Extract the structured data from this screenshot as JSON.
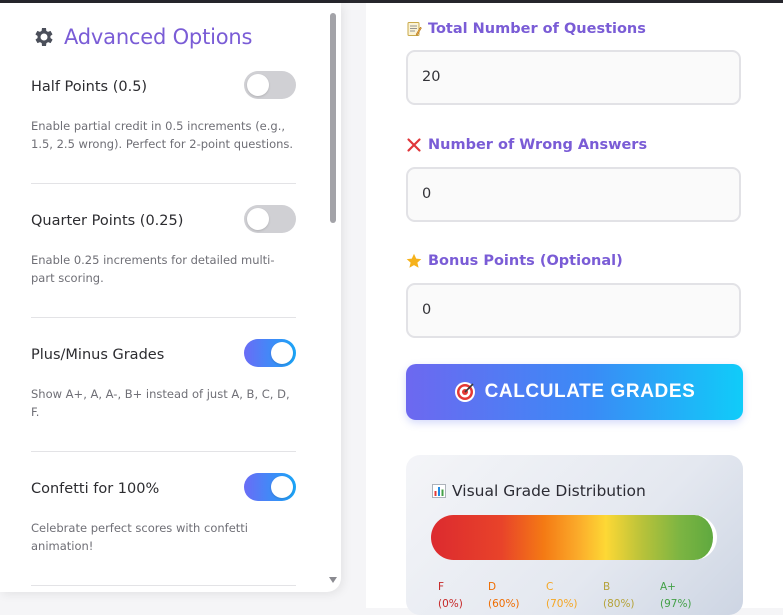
{
  "advanced": {
    "title": "Advanced Options",
    "options": [
      {
        "label": "Half Points (0.5)",
        "description": "Enable partial credit in 0.5 increments (e.g., 1.5, 2.5 wrong). Perfect for 2-point questions.",
        "enabled": false
      },
      {
        "label": "Quarter Points (0.25)",
        "description": "Enable 0.25 increments for detailed multi-part scoring.",
        "enabled": false
      },
      {
        "label": "Plus/Minus Grades",
        "description": "Show A+, A, A-, B+ instead of just A, B, C, D, F.",
        "enabled": true
      },
      {
        "label": "Confetti for 100%",
        "description": "Celebrate perfect scores with confetti animation!",
        "enabled": true
      }
    ]
  },
  "form": {
    "total_questions": {
      "label": "Total Number of Questions",
      "icon": "memo-icon",
      "value": "20"
    },
    "wrong_answers": {
      "label": "Number of Wrong Answers",
      "icon": "cross-mark-icon",
      "value": "0"
    },
    "bonus_points": {
      "label": "Bonus Points (Optional)",
      "icon": "star-icon",
      "value": "0"
    },
    "calculate_button": "CALCULATE GRADES"
  },
  "distribution": {
    "title": "Visual Grade Distribution",
    "marks": [
      {
        "grade": "F",
        "pct": "(0%)",
        "color": "#c62828"
      },
      {
        "grade": "D",
        "pct": "(60%)",
        "color": "#ef6c00"
      },
      {
        "grade": "C",
        "pct": "(70%)",
        "color": "#f5a623"
      },
      {
        "grade": "B",
        "pct": "(80%)",
        "color": "#b5a33a"
      },
      {
        "grade": "A+",
        "pct": "(97%)",
        "color": "#43a047"
      }
    ]
  },
  "colors": {
    "accent": "#7a5cd6",
    "toggle_on_start": "#6a6cf6",
    "toggle_on_end": "#1aa6f8"
  }
}
